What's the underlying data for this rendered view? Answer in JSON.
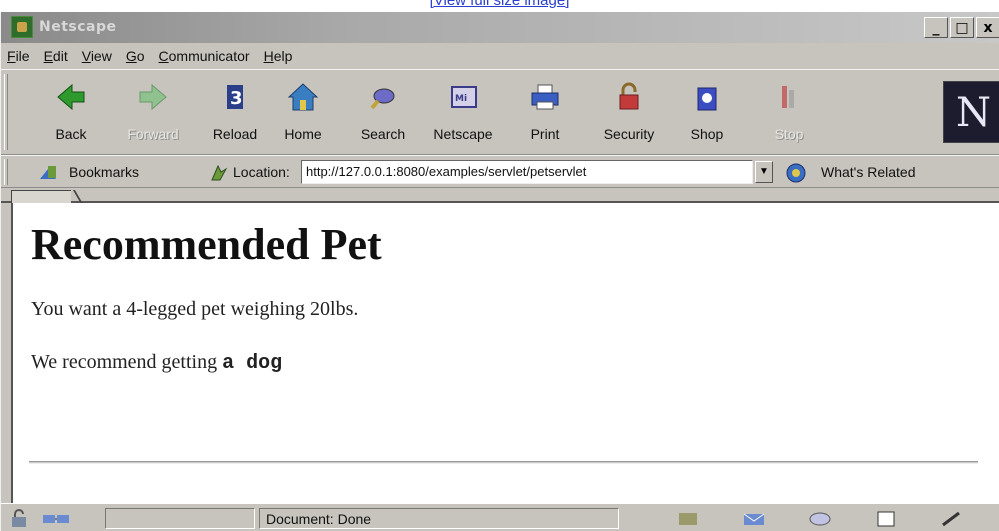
{
  "top_link": "[View full size image]",
  "window": {
    "title": "Netscape",
    "buttons": {
      "minimize": "_",
      "maximize": "□",
      "close": "x"
    }
  },
  "menu": [
    {
      "label": "File",
      "accel": "F",
      "rest": "ile"
    },
    {
      "label": "Edit",
      "accel": "E",
      "rest": "dit"
    },
    {
      "label": "View",
      "accel": "V",
      "rest": "iew"
    },
    {
      "label": "Go",
      "accel": "G",
      "rest": "o"
    },
    {
      "label": "Communicator",
      "accel": "C",
      "rest": "ommunicator"
    },
    {
      "label": "Help",
      "accel": "H",
      "rest": "elp"
    }
  ],
  "toolbar": {
    "back": "Back",
    "forward": "Forward",
    "reload": "Reload",
    "home": "Home",
    "search": "Search",
    "netscape": "Netscape",
    "print": "Print",
    "security": "Security",
    "shop": "Shop",
    "stop": "Stop"
  },
  "logo_letter": "N",
  "location": {
    "bookmarks_label": "Bookmarks",
    "location_label": "Location:",
    "url": "http://127.0.0.1:8080/examples/servlet/petservlet",
    "whats_related": "What's Related"
  },
  "page": {
    "heading": "Recommended Pet",
    "line1": "You want a 4-legged pet weighing 20lbs.",
    "line2_prefix": "We recommend getting ",
    "line2_bold": "a dog"
  },
  "status": {
    "text": "Document: Done"
  },
  "colors": {
    "chrome": "#c7c4bd",
    "link": "#2a3fd0"
  }
}
